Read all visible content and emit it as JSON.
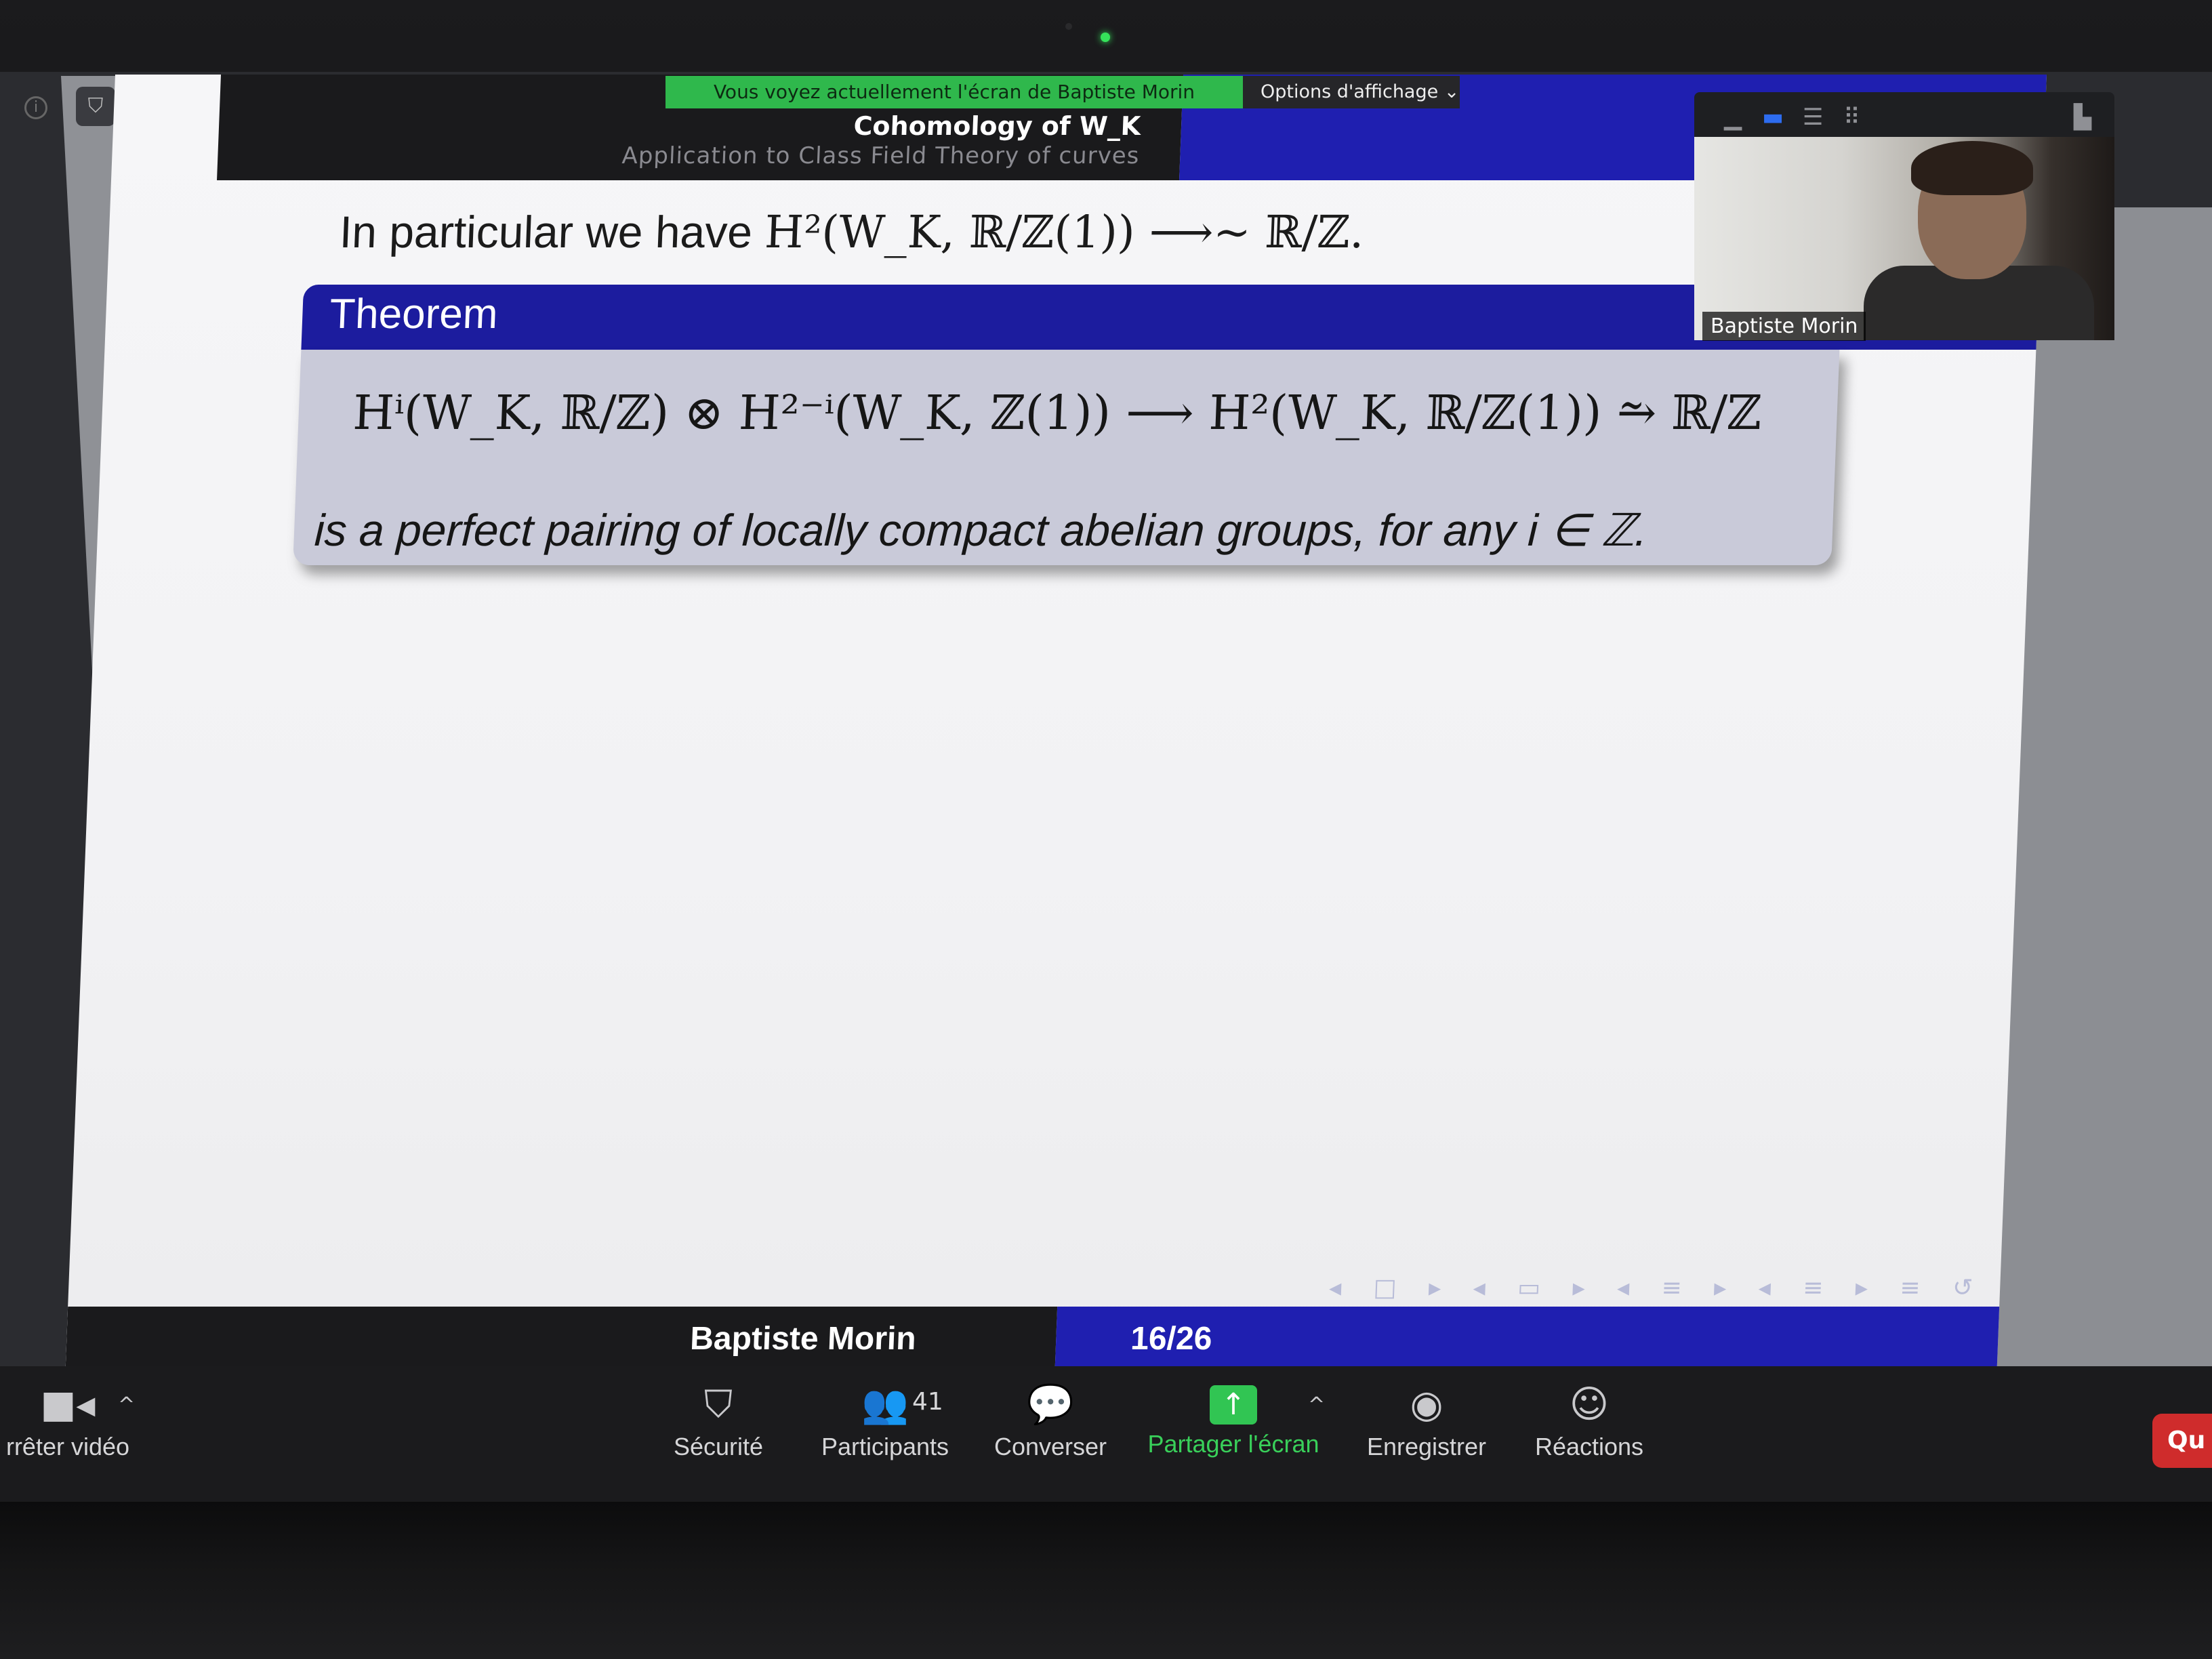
{
  "share_banner": {
    "text": "Vous voyez actuellement l'écran de Baptiste Morin",
    "view_options": "Options d'affichage ⌄"
  },
  "slide": {
    "header_title": "Cohomology of W_K",
    "header_subtitle": "Application to Class Field Theory of curves",
    "line1_text": "In particular we have ",
    "line1_math": "H²(W_K, ℝ/ℤ(1)) ⟶~ ℝ/ℤ.",
    "theorem_label": "Theorem",
    "theorem_formula": "Hⁱ(W_K, ℝ/ℤ) ⊗ H²⁻ⁱ(W_K, ℤ(1)) ⟶ H²(W_K, ℝ/ℤ(1)) ⥲ ℝ/ℤ",
    "theorem_sentence": "is a perfect pairing of locally compact abelian groups, for any i ∈ ℤ.",
    "nav_controls": "◂ □ ▸ ◂ ▭ ▸ ◂ ≡ ▸ ◂ ≡ ▸ ≡ ↺ ⚲",
    "footer_author": "Baptiste Morin",
    "footer_page": "16/26"
  },
  "video": {
    "participant_name": "Baptiste Morin",
    "layout_icons": [
      "minimize-icon",
      "speaker-view-icon",
      "strip-view-icon",
      "gallery-view-icon",
      "exit-fullscreen-icon"
    ]
  },
  "toolbar": {
    "stop_video": "rrêter vidéo",
    "security": "Sécurité",
    "participants": "Participants",
    "participants_count": "41",
    "chat": "Converser",
    "share_screen": "Partager l'écran",
    "record": "Enregistrer",
    "reactions": "Réactions",
    "quit": "Qu"
  },
  "colors": {
    "share_green": "#31c553",
    "beamer_blue": "#1f1fb0",
    "theorem_body": "#c9cad9",
    "quit_red": "#cf2c2c"
  }
}
